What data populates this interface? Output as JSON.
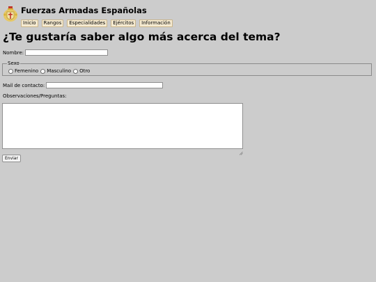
{
  "header": {
    "logo_icon": "coat-of-arms-icon",
    "title": "Fuerzas Armadas Españolas"
  },
  "nav": {
    "items": [
      "Inicio",
      "Rangos",
      "Especialidades",
      "Ejércitos",
      "Información"
    ]
  },
  "page": {
    "heading": "¿Te gustaría saber algo más acerca del tema?"
  },
  "form": {
    "name_label": "Nombre:",
    "name_value": "",
    "sex_legend": "Sexo",
    "sex_options": [
      "Femenino",
      "Masculino",
      "Otro"
    ],
    "mail_label": "Mail de contacto:",
    "mail_value": "",
    "observations_label": "Observaciones/Preguntas:",
    "observations_value": "",
    "submit_label": "Enviar"
  },
  "colors": {
    "background": "#cccccc",
    "nav_item_bg": "#f5ead0",
    "nav_item_border": "#c9b48a",
    "logo_gold": "#d8b23a",
    "logo_red": "#c0392b"
  }
}
